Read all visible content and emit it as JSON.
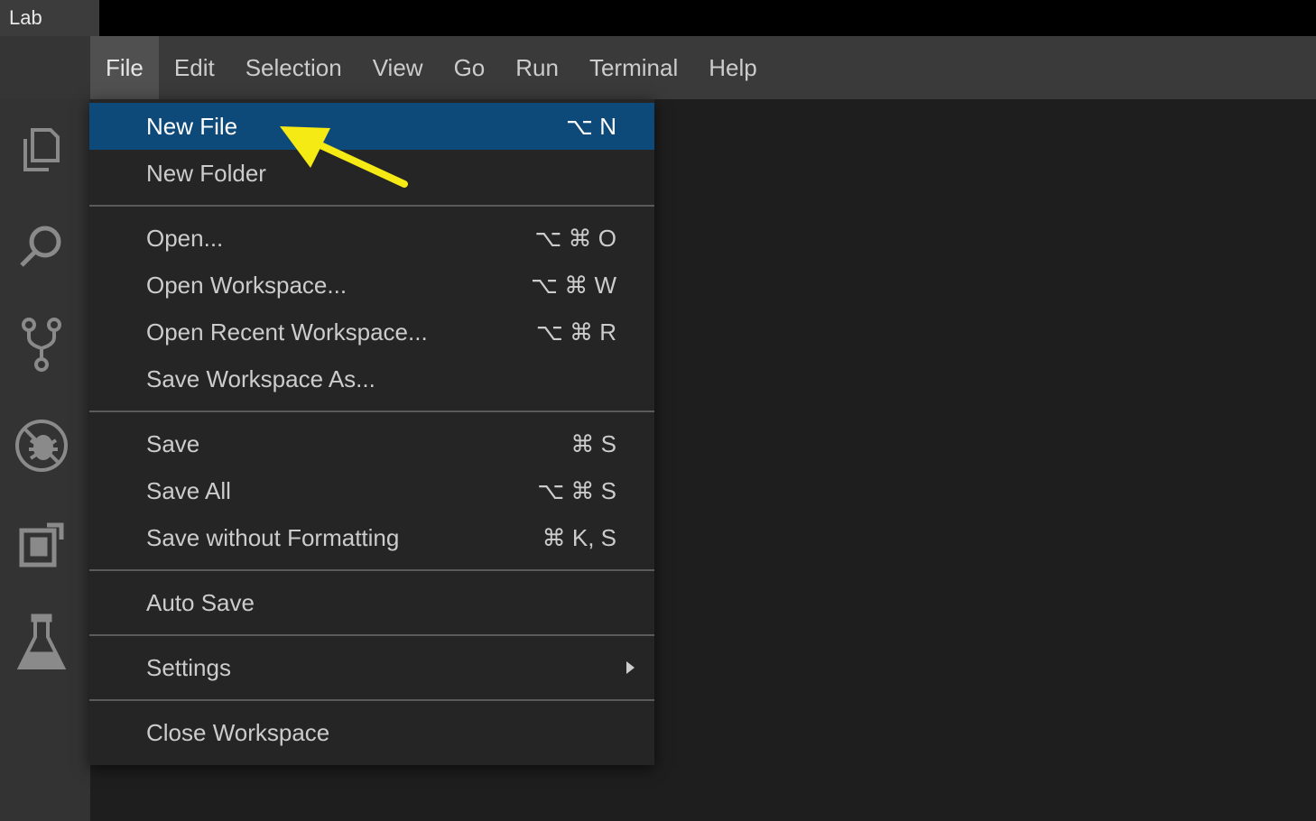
{
  "window": {
    "title": "Lab"
  },
  "menubar": {
    "items": [
      {
        "label": "File",
        "active": true
      },
      {
        "label": "Edit"
      },
      {
        "label": "Selection"
      },
      {
        "label": "View"
      },
      {
        "label": "Go"
      },
      {
        "label": "Run"
      },
      {
        "label": "Terminal"
      },
      {
        "label": "Help"
      }
    ]
  },
  "activitybar": {
    "icons": [
      "files-icon",
      "search-icon",
      "source-control-icon",
      "debug-icon",
      "extensions-icon",
      "lab-flask-icon"
    ]
  },
  "file_menu": {
    "new_file": {
      "label": "New File",
      "shortcut": "⌥ N"
    },
    "new_folder": {
      "label": "New Folder"
    },
    "open": {
      "label": "Open...",
      "shortcut": "⌥ ⌘ O"
    },
    "open_workspace": {
      "label": "Open Workspace...",
      "shortcut": "⌥ ⌘ W"
    },
    "open_recent_workspace": {
      "label": "Open Recent Workspace...",
      "shortcut": "⌥ ⌘ R"
    },
    "save_workspace_as": {
      "label": "Save Workspace As..."
    },
    "save": {
      "label": "Save",
      "shortcut": "⌘ S"
    },
    "save_all": {
      "label": "Save All",
      "shortcut": "⌥ ⌘ S"
    },
    "save_without_formatting": {
      "label": "Save without Formatting",
      "shortcut": "⌘ K, S"
    },
    "auto_save": {
      "label": "Auto Save"
    },
    "settings": {
      "label": "Settings"
    },
    "close_workspace": {
      "label": "Close Workspace"
    }
  },
  "colors": {
    "highlight": "#0d4a7a",
    "annotation_arrow": "#f5ea14",
    "menu_bg": "#252526"
  }
}
